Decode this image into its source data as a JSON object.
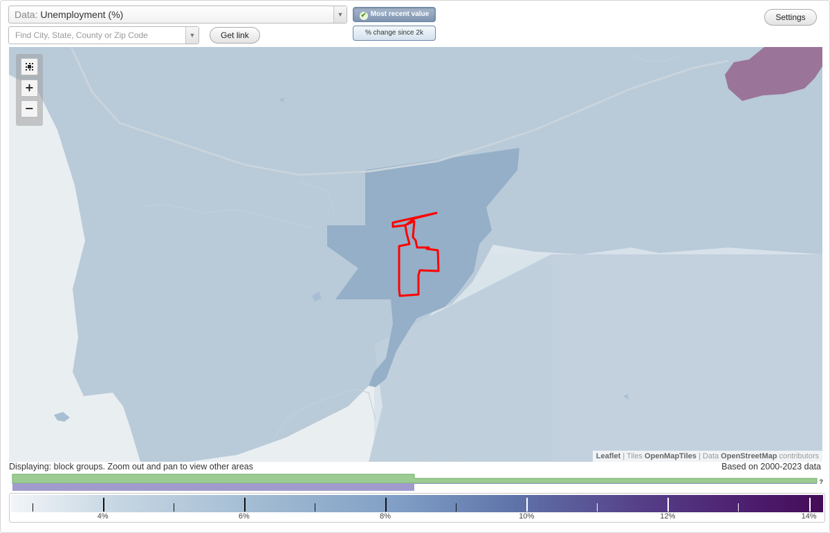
{
  "data_select": {
    "prefix": "Data:",
    "value": "Unemployment (%)"
  },
  "search": {
    "placeholder": "Find City, State, County or Zip Code",
    "value": ""
  },
  "buttons": {
    "get_link": "Get link",
    "settings": "Settings"
  },
  "view_toggle": {
    "active": "Most recent value",
    "inactive": "% change since 2k"
  },
  "map": {
    "attribution": {
      "leaflet": "Leaflet",
      "sep1": " | Tiles ",
      "tiles": "OpenMapTiles",
      "sep2": " | Data ",
      "data": "OpenStreetMap",
      "contributors": " contributors"
    },
    "region_colors": {
      "light": "#b9cad9",
      "mid": "#94afc7",
      "outlier": "#9a7599",
      "selected_outline": "#ff0000"
    }
  },
  "status": {
    "displaying": "Displaying: block groups. Zoom out and pan to view other areas",
    "based_on": "Based on 2000-2023 data"
  },
  "histogram": {
    "unknown_marker": "?",
    "colors": {
      "primary": "#9ccc93",
      "secondary": "#a19bcd"
    }
  },
  "legend": {
    "labels": [
      "4%",
      "6%",
      "8%",
      "10%",
      "12%",
      "14%"
    ],
    "values": [
      4,
      6,
      8,
      10,
      12,
      14
    ],
    "range": [
      2.7,
      14.2
    ],
    "colors": [
      "#f2f5f8",
      "#a3bcd3",
      "#7f9ec5",
      "#5f73a9",
      "#553e87",
      "#440c57"
    ]
  }
}
